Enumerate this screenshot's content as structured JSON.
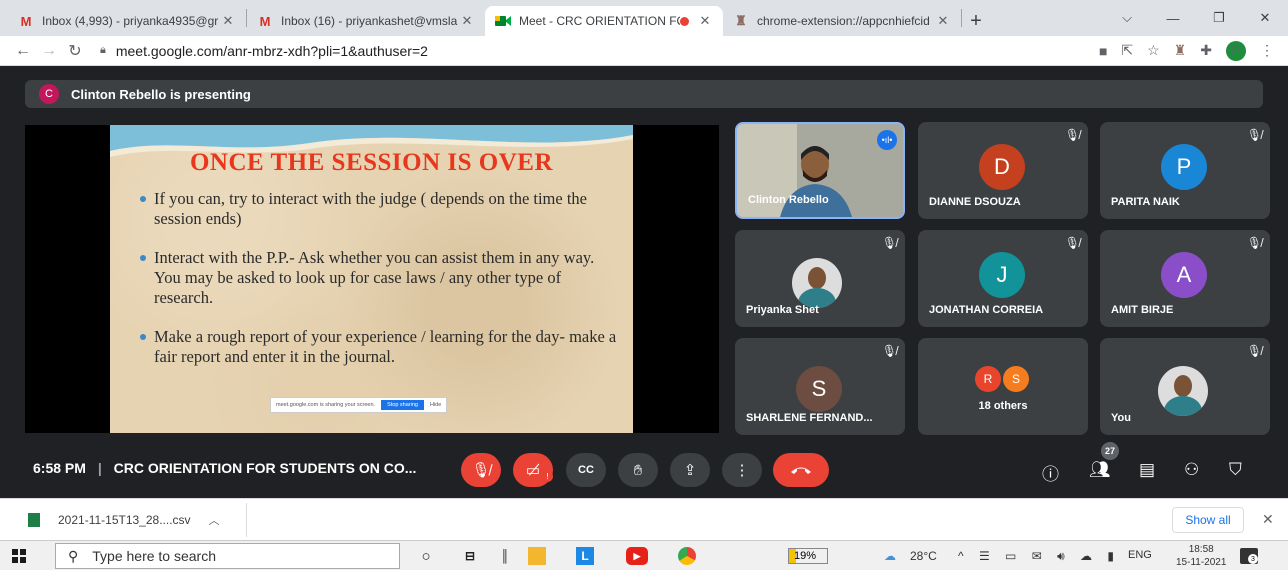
{
  "browser": {
    "tabs": [
      {
        "title": "Inbox (4,993) - priyanka4935@gr",
        "icon": "gmail-icon",
        "active": false
      },
      {
        "title": "Inbox (16) - priyankashet@vmsla",
        "icon": "gmail-icon",
        "active": false
      },
      {
        "title": "Meet - CRC ORIENTATION FO",
        "icon": "meet-icon",
        "active": true
      },
      {
        "title": "chrome-extension://appcnhiefcid",
        "icon": "extension-icon",
        "active": false
      }
    ],
    "new_tab": "+",
    "url": "meet.google.com/anr-mbrz-xdh?pli=1&authuser=2",
    "profile_initial": "P"
  },
  "meet": {
    "presenting_banner": "Clinton Rebello is presenting",
    "presenter_initial": "C",
    "slide": {
      "title": "ONCE THE SESSION IS OVER",
      "bullets": [
        "If you can, try to interact with the judge ( depends on the time the session ends)",
        "Interact with the P.P.- Ask whether you can assist them in any way. You may be asked to look up for case laws / any other type of research.",
        "Make a rough report of your experience / learning for the day- make a fair report and enter it in the journal."
      ],
      "share_notice": "meet.google.com is sharing your screen.",
      "stop_sharing": "Stop sharing",
      "hide": "Hide"
    },
    "participants": [
      {
        "name": "Clinton Rebello",
        "type": "video"
      },
      {
        "name": "DIANNE DSOUZA",
        "initial": "D",
        "color": "#c5401f"
      },
      {
        "name": "PARITA NAIK",
        "initial": "P",
        "color": "#1a86d6"
      },
      {
        "name": "Priyanka Shet",
        "type": "photo"
      },
      {
        "name": "JONATHAN CORREIA",
        "initial": "J",
        "color": "#12939a"
      },
      {
        "name": "AMIT BIRJE",
        "initial": "A",
        "color": "#8a4fc8"
      },
      {
        "name": "SHARLENE FERNAND...",
        "initial": "S",
        "color": "#6d4c41"
      },
      {
        "name": "18 others",
        "initials": [
          "R",
          "S"
        ],
        "colors": [
          "#e8452c",
          "#f57c1f"
        ]
      },
      {
        "name": "You",
        "type": "photo"
      }
    ],
    "controls": {
      "time": "6:58 PM",
      "meeting_title": "CRC ORIENTATION FOR STUDENTS ON CO...",
      "people_count": "27"
    }
  },
  "downloads": {
    "file": "2021-11-15T13_28....csv",
    "show_all": "Show all"
  },
  "taskbar": {
    "search_placeholder": "Type here to search",
    "battery": "19%",
    "battery_level": 0.19,
    "weather": "28°C",
    "language": "ENG",
    "time": "18:58",
    "date": "15-11-2021",
    "notifications": "3"
  }
}
